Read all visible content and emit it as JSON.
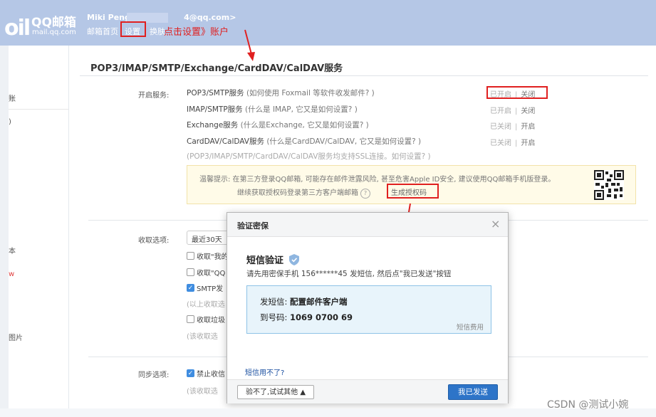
{
  "header": {
    "logo_mark": "oil",
    "logo_name": "QQ邮箱",
    "logo_domain": "mail.qq.com",
    "user_name": "Miki Peng<",
    "user_email_tail": "4@qq.com>",
    "nav": [
      "邮箱首页",
      "设置",
      "换肤"
    ],
    "annotation": "点击设置》账户"
  },
  "sidebar": {
    "fragments": [
      "账",
      ")",
      "本",
      "w",
      "图片"
    ]
  },
  "main": {
    "title": "POP3/IMAP/SMTP/Exchange/CardDAV/CalDAV服务",
    "enable_label": "开启服务:",
    "services": [
      {
        "name": "POP3/SMTP服务",
        "sub": " (如何使用 Foxmail 等软件收发邮件? )",
        "status": "已开启",
        "action": "关闭"
      },
      {
        "name": "IMAP/SMTP服务",
        "sub": " (什么是 IMAP, 它又是如何设置? )",
        "status": "已开启",
        "action": "关闭"
      },
      {
        "name": "Exchange服务",
        "sub": " (什么是Exchange, 它又是如何设置? )",
        "status": "已关闭",
        "action": "开启"
      },
      {
        "name": "CardDAV/CalDAV服务",
        "sub": " (什么是CardDAV/CalDAV, 它又是如何设置? )",
        "status": "已关闭",
        "action": "开启"
      }
    ],
    "ssl_note": "(POP3/IMAP/SMTP/CardDAV/CalDAV服务均支持SSL连接。如何设置? )",
    "tip_line1": "温馨提示: 在第三方登录QQ邮箱, 可能存在邮件泄露风险, 甚至危害Apple ID安全, 建议使用QQ邮箱手机版登录。",
    "tip_line2": "继续获取授权码登录第三方客户端邮箱",
    "help_q": "?",
    "gen_code": "生成授权码",
    "receive_label": "收取选项:",
    "receive_select": "最近30天",
    "receive_options": [
      {
        "label": "收取\"我的",
        "checked": false
      },
      {
        "label": "收取\"QQ",
        "checked": false
      },
      {
        "label": "SMTP发",
        "checked": true
      },
      {
        "label": "(以上收取选",
        "muted": true
      },
      {
        "label": "收取垃圾",
        "checked": false
      },
      {
        "label": "(该收取选",
        "muted": true
      }
    ],
    "sync_label": "同步选项:",
    "sync_options": [
      {
        "label": "禁止收信",
        "checked": true
      },
      {
        "label": "(该收取选",
        "muted": true
      }
    ]
  },
  "modal": {
    "title": "验证密保",
    "close": "×",
    "sms_title": "短信验证",
    "desc": "请先用密保手机 156******45 发短信, 然后点\"我已发送\"按钮",
    "content_label": "发短信: ",
    "content_value": "配置邮件客户端",
    "number_label": "到号码: ",
    "number_value": "1069 0700 69",
    "fee": "短信费用",
    "help_link": "短信用不了?",
    "alt_button": "验不了,试试其他 ▲",
    "sent_button": "我已发送"
  },
  "watermark": "CSDN @测试小婉"
}
